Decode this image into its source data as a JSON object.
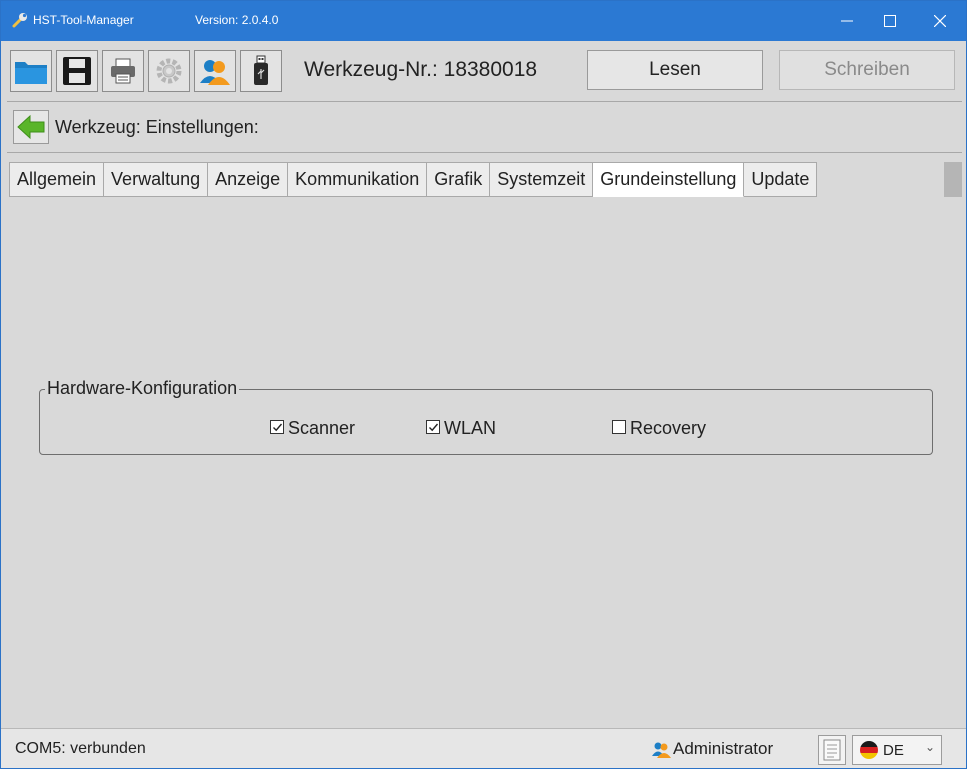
{
  "window": {
    "title": "HST-Tool-Manager",
    "version": "Version: 2.0.4.0",
    "accent_color": "#2b79d3"
  },
  "toolbar": {
    "icons": [
      "folder-icon",
      "save-icon",
      "printer-icon",
      "settings-gear-icon",
      "user-icon",
      "usb-stick-icon"
    ],
    "tool_number": "Werkzeug-Nr.: 18380018",
    "read_label": "Lesen",
    "write_label": "Schreiben"
  },
  "breadcrumb": {
    "text": "Werkzeug: Einstellungen:"
  },
  "tabs": [
    {
      "label": "Allgemein"
    },
    {
      "label": "Verwaltung"
    },
    {
      "label": "Anzeige"
    },
    {
      "label": "Kommunikation"
    },
    {
      "label": "Grafik"
    },
    {
      "label": "Systemzeit"
    },
    {
      "label": "Grundeinstellung"
    },
    {
      "label": "Update"
    }
  ],
  "active_tab": "Grundeinstellung",
  "hardware": {
    "title": "Hardware-Konfiguration",
    "options": [
      {
        "label": "Scanner",
        "checked": true
      },
      {
        "label": "WLAN",
        "checked": true
      },
      {
        "label": "Recovery",
        "checked": false
      }
    ]
  },
  "status": {
    "connection": "COM5: verbunden",
    "user": "Administrator",
    "language": "DE"
  }
}
